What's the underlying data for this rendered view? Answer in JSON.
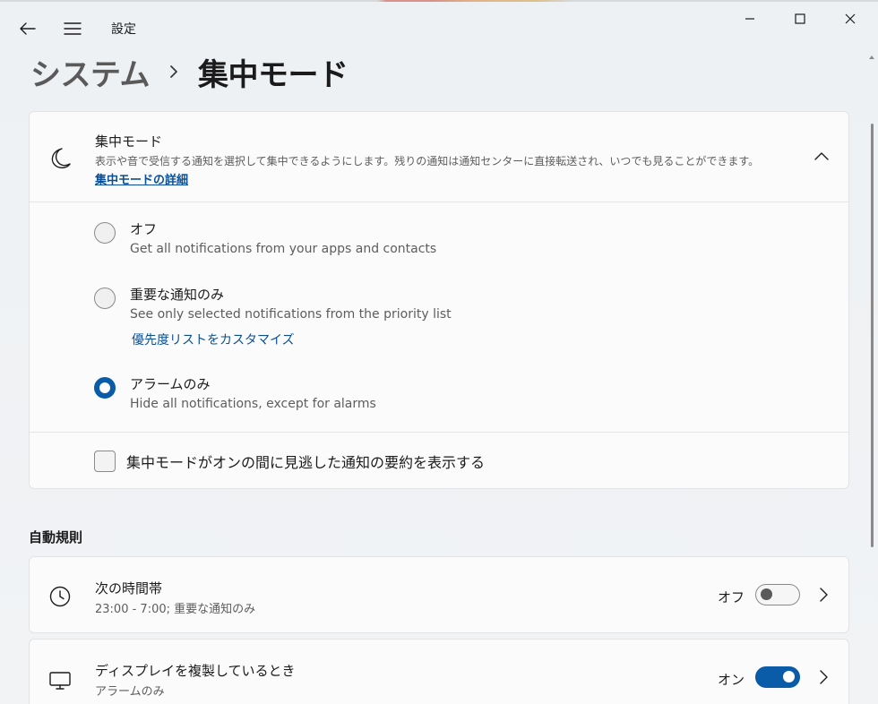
{
  "window": {
    "app_title": "設定"
  },
  "breadcrumb": {
    "parent": "システム",
    "current": "集中モード"
  },
  "focus_card": {
    "title": "集中モード",
    "description": "表示や音で受信する通知を選択して集中できるようにします。残りの通知は通知センターに直接転送され、いつでも見ることができます。",
    "link": "集中モードの詳細",
    "expanded": true,
    "options": [
      {
        "label": "オフ",
        "description": "Get all notifications from your apps and contacts",
        "selected": false
      },
      {
        "label": "重要な通知のみ",
        "description": "See only selected notifications from the priority list",
        "link": "優先度リストをカスタマイズ",
        "selected": false
      },
      {
        "label": "アラームのみ",
        "description": "Hide all notifications, except for alarms",
        "selected": true
      }
    ],
    "summary_checkbox": {
      "label": "集中モードがオンの間に見逃した通知の要約を表示する",
      "checked": false
    }
  },
  "auto_rules": {
    "section_title": "自動規則",
    "rules": [
      {
        "title": "次の時間帯",
        "subtitle": "23:00 - 7:00; 重要な通知のみ",
        "state_label": "オフ",
        "enabled": false,
        "icon": "clock-icon"
      },
      {
        "title": "ディスプレイを複製しているとき",
        "subtitle": "アラームのみ",
        "state_label": "オン",
        "enabled": true,
        "icon": "monitor-icon"
      }
    ]
  },
  "colors": {
    "accent": "#0a5ba8",
    "link": "#0a4f96",
    "background": "#f3f3f3",
    "card": "#fbfbfb"
  }
}
